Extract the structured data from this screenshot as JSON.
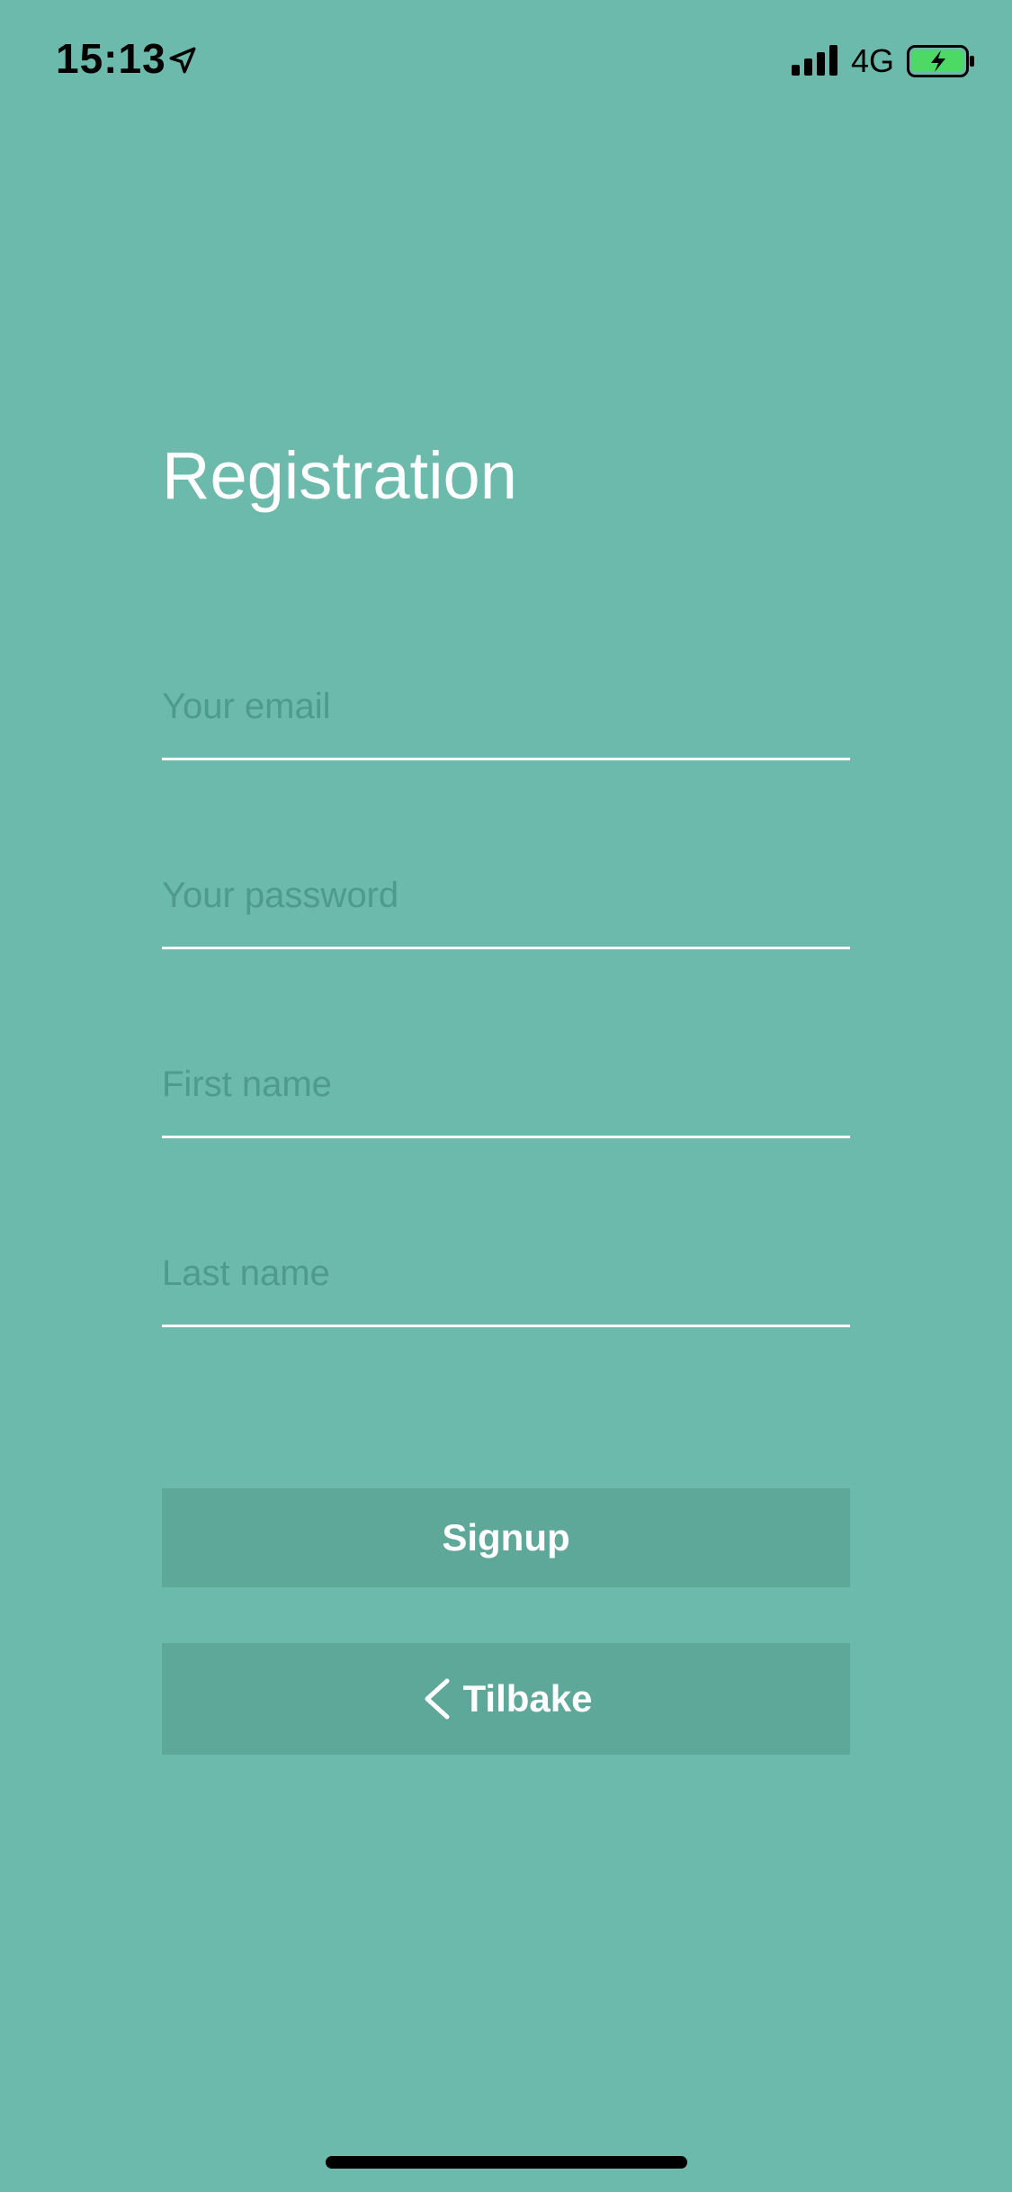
{
  "status_bar": {
    "time": "15:13",
    "network": "4G",
    "battery_color": "#4cd964"
  },
  "page": {
    "title": "Registration",
    "background": "#6cbaab"
  },
  "form": {
    "email": {
      "value": "",
      "placeholder": "Your email"
    },
    "password": {
      "value": "",
      "placeholder": "Your password"
    },
    "first_name": {
      "value": "",
      "placeholder": "First name"
    },
    "last_name": {
      "value": "",
      "placeholder": "Last name"
    }
  },
  "buttons": {
    "signup_label": "Signup",
    "back_label": "Tilbake"
  },
  "icons": [
    "location-arrow-icon",
    "cellular-signal-icon",
    "battery-charging-icon",
    "chevron-left-icon"
  ]
}
